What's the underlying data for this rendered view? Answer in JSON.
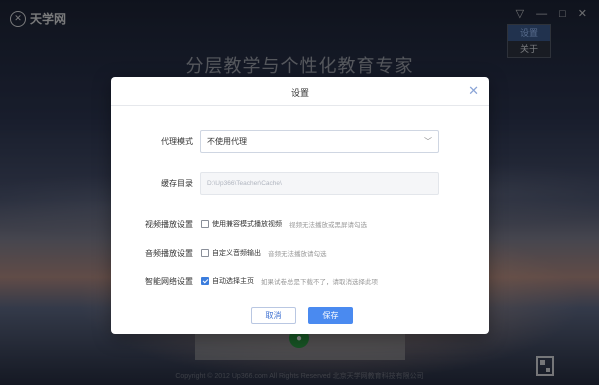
{
  "app": {
    "logo_text": "天学网",
    "slogan": "分层教学与个性化教育专家",
    "copyright": "Copyright © 2012 Up366.com All Rights Reserved 北京天学网教育科技有限公司"
  },
  "window_controls": {
    "menu": "▽",
    "minimize": "—",
    "maximize": "□",
    "close": "✕"
  },
  "context_menu": {
    "items": [
      "设置",
      "关于"
    ],
    "active_index": 0
  },
  "dialog": {
    "title": "设置",
    "proxy": {
      "label": "代理模式",
      "value": "不使用代理"
    },
    "cache": {
      "label": "缓存目录",
      "value": "D:\\Up366\\Teacher\\Cache\\"
    },
    "video": {
      "label": "视频播放设置",
      "checkbox_label": "使用兼容模式播放视频",
      "hint": "视频无法播放或黑屏请勾选",
      "checked": false
    },
    "audio": {
      "label": "音频播放设置",
      "checkbox_label": "自定义音频输出",
      "hint": "音频无法播放请勾选",
      "checked": false
    },
    "network": {
      "label": "智能网络设置",
      "checkbox_label": "自动选择主页",
      "hint": "如果试卷总是下载不了，请取消选择此项",
      "checked": true
    },
    "buttons": {
      "cancel": "取消",
      "save": "保存"
    }
  },
  "colors": {
    "accent": "#4a8af0",
    "menu_active": "#3d5b8f"
  }
}
